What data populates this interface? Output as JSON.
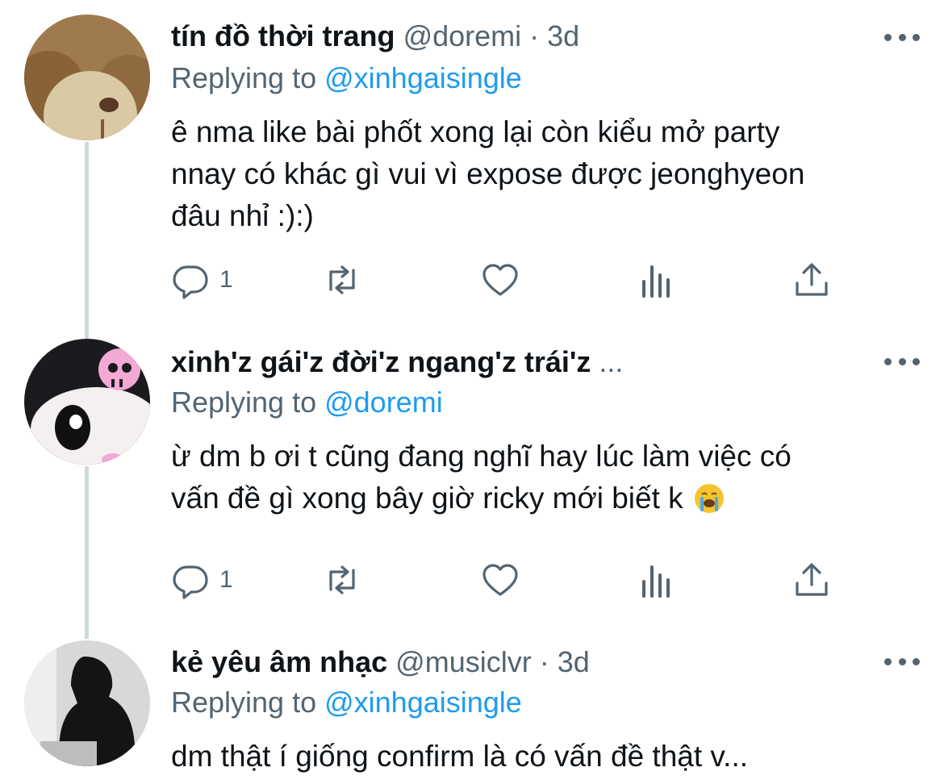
{
  "tweets": [
    {
      "name": "tín đồ thời trang",
      "handle": "@doremi",
      "sep": " · ",
      "time": "3d",
      "replying_prefix": "Replying to ",
      "replying_to": "@xinhgaisingle",
      "text_lines": [
        "ê nma like bài phốt xong lại còn kiểu mở party",
        "nnay có khác gì vui vì expose được jeonghyeon",
        "đâu nhỉ :):)"
      ],
      "reply_count": "1",
      "avatar_icon": "teddy-bear-avatar"
    },
    {
      "name": "xinh'z gái'z đời'z ngang'z trái'z",
      "ellipsis": " ...",
      "replying_prefix": "Replying to ",
      "replying_to": "@doremi",
      "text_lines": [
        "ừ dm b ơi t cũng đang nghĩ hay lúc làm việc có",
        "vấn đề gì xong bây giờ ricky mới biết k"
      ],
      "emoji": "loudly-crying-face",
      "reply_count": "1",
      "avatar_icon": "kuromi-avatar"
    },
    {
      "name": "kẻ yêu âm nhạc",
      "handle": "@musiclvr",
      "sep": " · ",
      "time": "3d",
      "replying_prefix": "Replying to ",
      "replying_to": "@xinhgaisingle",
      "text_lines": [
        "dm thật í giống confirm là có vấn đề thật v..."
      ],
      "avatar_icon": "hooded-person-avatar"
    }
  ],
  "colors": {
    "accent": "#1d9bf0",
    "muted": "#536471",
    "text": "#0f1419"
  }
}
